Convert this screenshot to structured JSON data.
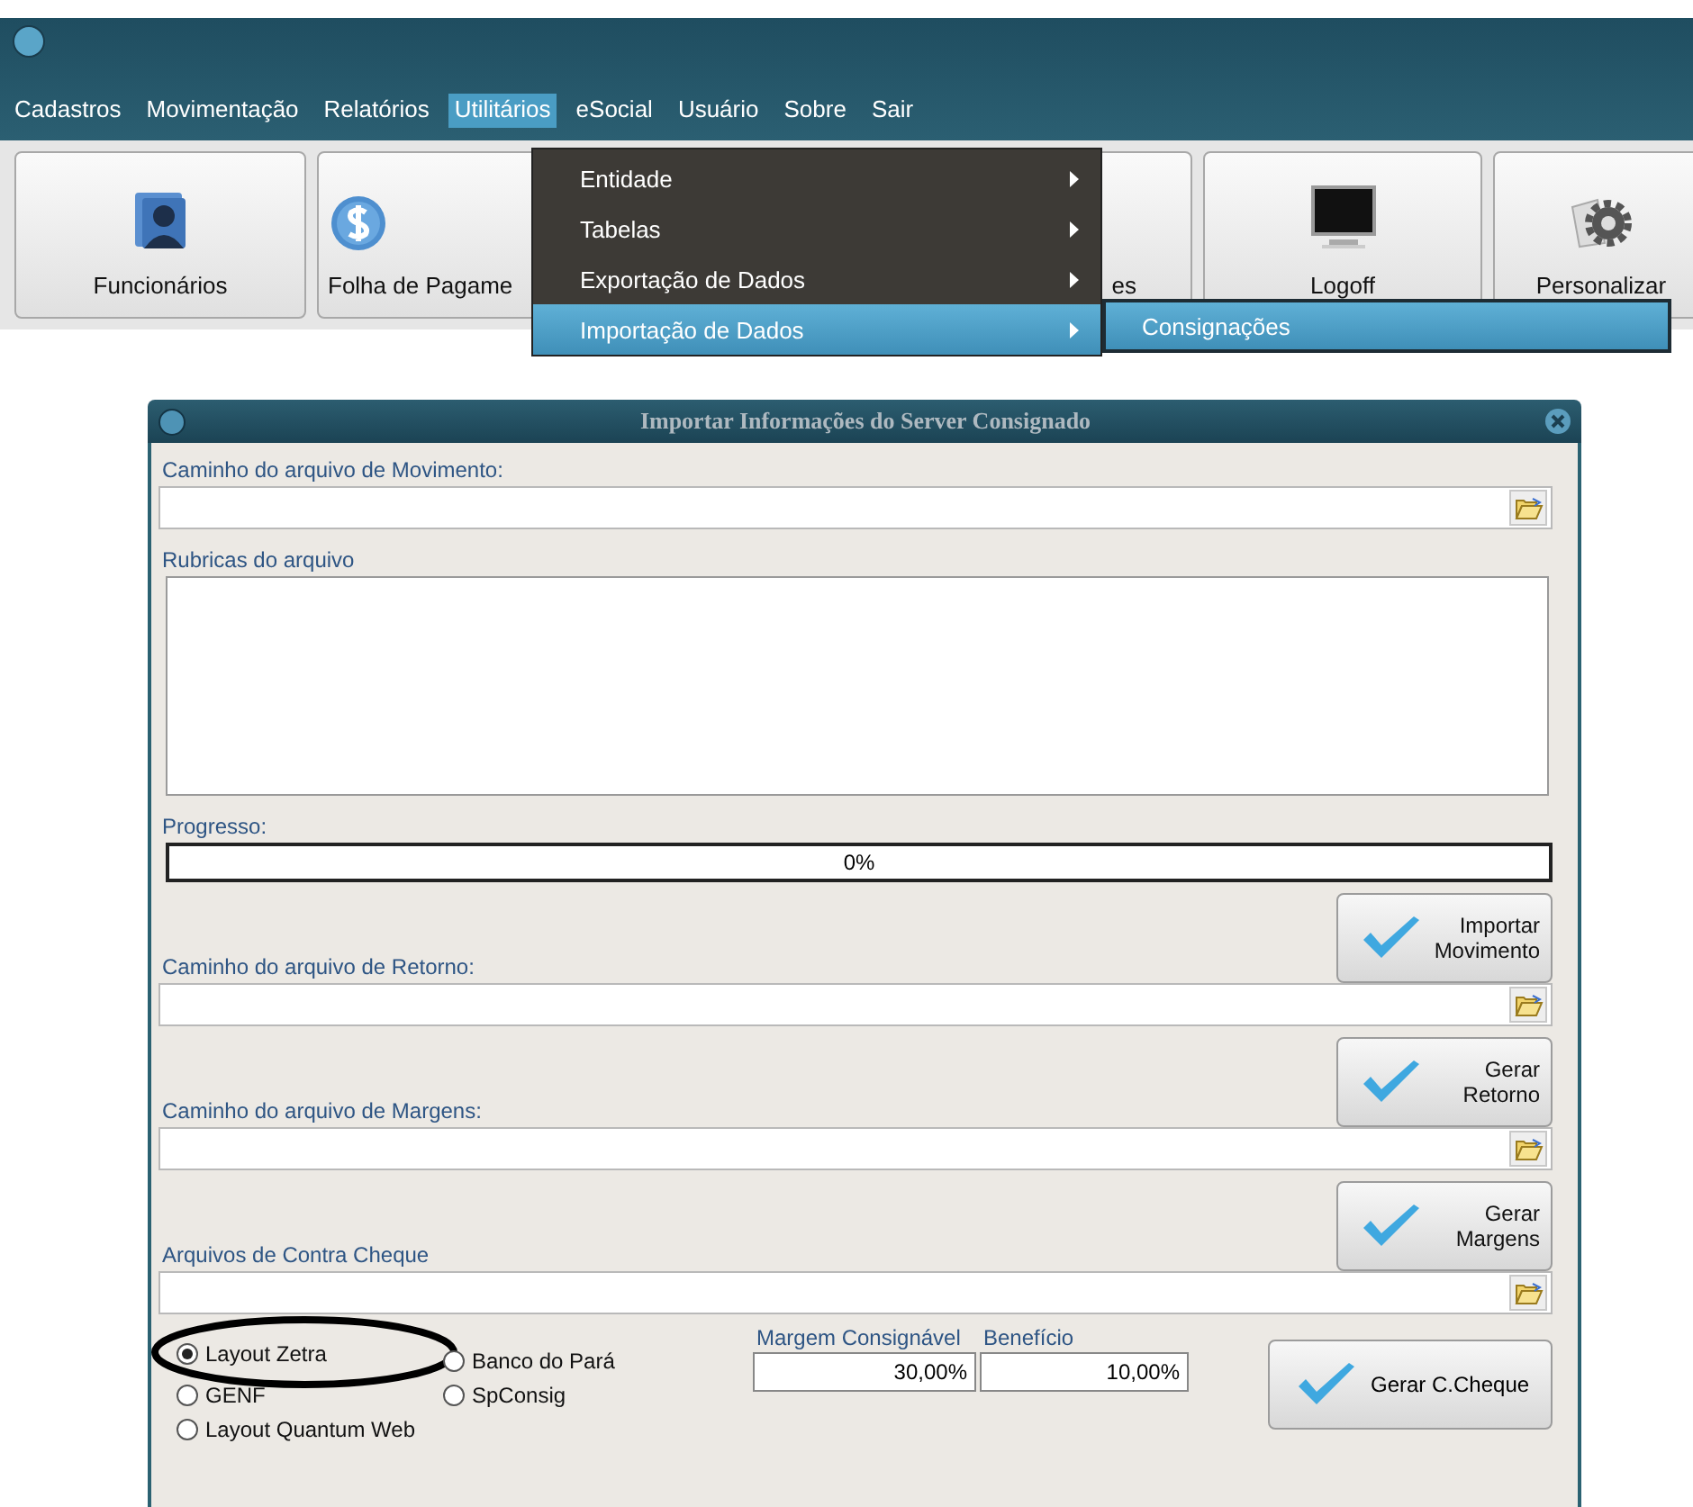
{
  "app": {
    "menu": [
      {
        "label": "Cadastros",
        "selected": false
      },
      {
        "label": "Movimentação",
        "selected": false
      },
      {
        "label": "Relatórios",
        "selected": false
      },
      {
        "label": "Utilitários",
        "selected": true
      },
      {
        "label": "eSocial",
        "selected": false
      },
      {
        "label": "Usuário",
        "selected": false
      },
      {
        "label": "Sobre",
        "selected": false
      },
      {
        "label": "Sair",
        "selected": false
      }
    ],
    "toolbar": [
      {
        "kind": "people",
        "label": "Funcionários"
      },
      {
        "kind": "dollar",
        "label": "Folha de Pagame"
      },
      {
        "kind": "plain",
        "label": "es"
      },
      {
        "kind": "monitor",
        "label": "Logoff"
      },
      {
        "kind": "gear",
        "label": "Personalizar"
      }
    ],
    "dropdown": [
      {
        "label": "Entidade",
        "selected": false
      },
      {
        "label": "Tabelas",
        "selected": false
      },
      {
        "label": "Exportação de Dados",
        "selected": false
      },
      {
        "label": "Importação de Dados",
        "selected": true
      }
    ],
    "submenu": [
      {
        "label": "Consignações",
        "selected": true
      }
    ]
  },
  "dialog": {
    "title": "Importar Informações do Server Consignado",
    "sections": [
      {
        "kind": "file",
        "label": "Caminho do arquivo de Movimento:"
      },
      {
        "kind": "memo",
        "label": "Rubricas do arquivo"
      },
      {
        "kind": "progress",
        "label": "Progresso:",
        "level": 0,
        "reading": "0%"
      },
      {
        "kind": "action",
        "button": "Importar Movimento"
      },
      {
        "kind": "file",
        "label": "Caminho do arquivo de Retorno:"
      },
      {
        "kind": "action",
        "button": "Gerar Retorno"
      },
      {
        "kind": "file",
        "label": "Caminho do arquivo de Margens:"
      },
      {
        "kind": "action",
        "button": "Gerar Margens"
      },
      {
        "kind": "file",
        "label": "Arquivos de Contra Cheque"
      }
    ],
    "radio_columns": [
      [
        {
          "label": "Layout Zetra",
          "selected": true,
          "circled": true
        },
        {
          "label": "GENF",
          "selected": false,
          "circled": false
        },
        {
          "label": "Layout Quantum Web",
          "selected": false,
          "circled": false
        }
      ],
      [
        {
          "label": "Banco do Pará",
          "selected": false,
          "circled": false
        },
        {
          "label": "SpConsig",
          "selected": false,
          "circled": false
        }
      ]
    ],
    "margin_fields": [
      {
        "label": "Margem Consignável",
        "value": "30,00%"
      },
      {
        "label": "Benefício",
        "value": "10,00%"
      }
    ],
    "final_button": "Gerar C.Cheque"
  }
}
